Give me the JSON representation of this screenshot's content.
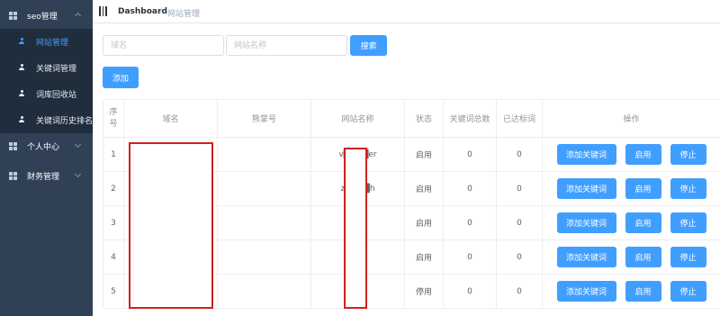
{
  "sidebar": {
    "groups": [
      {
        "label": "seo管理",
        "expanded": true
      },
      {
        "label": "个人中心",
        "expanded": false
      },
      {
        "label": "财务管理",
        "expanded": false
      }
    ],
    "seo_items": [
      {
        "label": "网站管理",
        "active": true
      },
      {
        "label": "关键词管理",
        "active": false
      },
      {
        "label": "词库回收站",
        "active": false
      },
      {
        "label": "关键词历史排名",
        "active": false
      }
    ]
  },
  "breadcrumb": {
    "home": "Dashboard",
    "separator": "/",
    "current": "网站管理"
  },
  "search": {
    "domain_placeholder": "域名",
    "sitename_placeholder": "网站名称",
    "search_label": "搜索",
    "add_label": "添加"
  },
  "table": {
    "headers": {
      "index": "序号",
      "domain": "域名",
      "baidu_id": "熊掌号",
      "site_name": "网站名称",
      "status": "状态",
      "kw_total": "关键词总数",
      "kw_reached": "已达标词",
      "ops": "操作"
    },
    "rows": [
      {
        "index": "1",
        "domain": "",
        "baidu_id": "",
        "site_name": "v████er",
        "status": "启用",
        "kw_total": "0",
        "kw_reached": "0"
      },
      {
        "index": "2",
        "domain": "",
        "baidu_id": "",
        "site_name": "z████h",
        "status": "启用",
        "kw_total": "0",
        "kw_reached": "0"
      },
      {
        "index": "3",
        "domain": "",
        "baidu_id": "",
        "site_name": "",
        "status": "启用",
        "kw_total": "0",
        "kw_reached": "0"
      },
      {
        "index": "4",
        "domain": "",
        "baidu_id": "",
        "site_name": "",
        "status": "启用",
        "kw_total": "0",
        "kw_reached": "0"
      },
      {
        "index": "5",
        "domain": "",
        "baidu_id": "",
        "site_name": "",
        "status": "停用",
        "kw_total": "0",
        "kw_reached": "0"
      }
    ],
    "op_labels": {
      "add_keyword": "添加关键词",
      "enable": "启用",
      "disable": "停止"
    }
  },
  "colors": {
    "sidebar_bg": "#304156",
    "submenu_bg": "#1f2d3d",
    "active": "#409eff",
    "primary": "#409eff",
    "redaction": "#d0201f"
  }
}
